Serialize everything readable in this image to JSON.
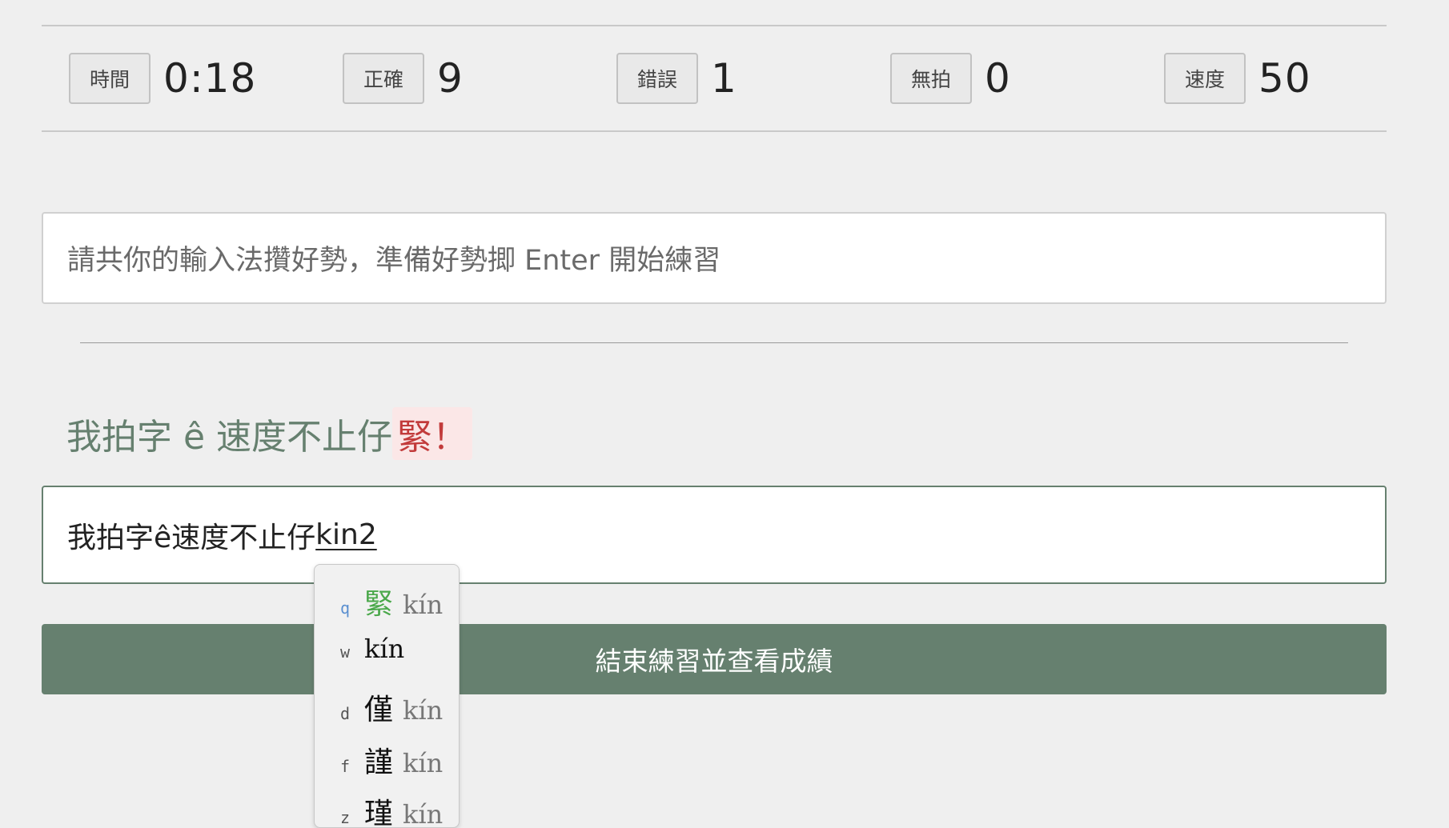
{
  "stats": [
    {
      "label": "時間",
      "value": "0:18"
    },
    {
      "label": "正確",
      "value": "9"
    },
    {
      "label": "錯誤",
      "value": "1"
    },
    {
      "label": "無拍",
      "value": "0"
    },
    {
      "label": "速度",
      "value": "50"
    }
  ],
  "prompt": {
    "text": "請共你的輸入法攢好勢，準備好勢揤 Enter 開始練習"
  },
  "target": {
    "done_text": "我拍字 ê 速度不止仔",
    "current_text": "緊！"
  },
  "typing": {
    "committed": "我拍字ê速度不止仔",
    "composing": "kin2"
  },
  "end_button": {
    "label": "結束練習並查看成績"
  },
  "ime": {
    "candidates": [
      {
        "key": "q",
        "char": "緊",
        "roman": "kín"
      },
      {
        "key": "w",
        "char": "",
        "roman": "kín"
      },
      {
        "key": "d",
        "char": "僅",
        "roman": "kín"
      },
      {
        "key": "f",
        "char": "謹",
        "roman": "kín"
      },
      {
        "key": "z",
        "char": "瑾",
        "roman": "kín"
      }
    ]
  },
  "colors": {
    "accent": "#66806f",
    "error": "#c23b3b",
    "error_bg": "#fbe7e7",
    "background": "#efefef"
  }
}
